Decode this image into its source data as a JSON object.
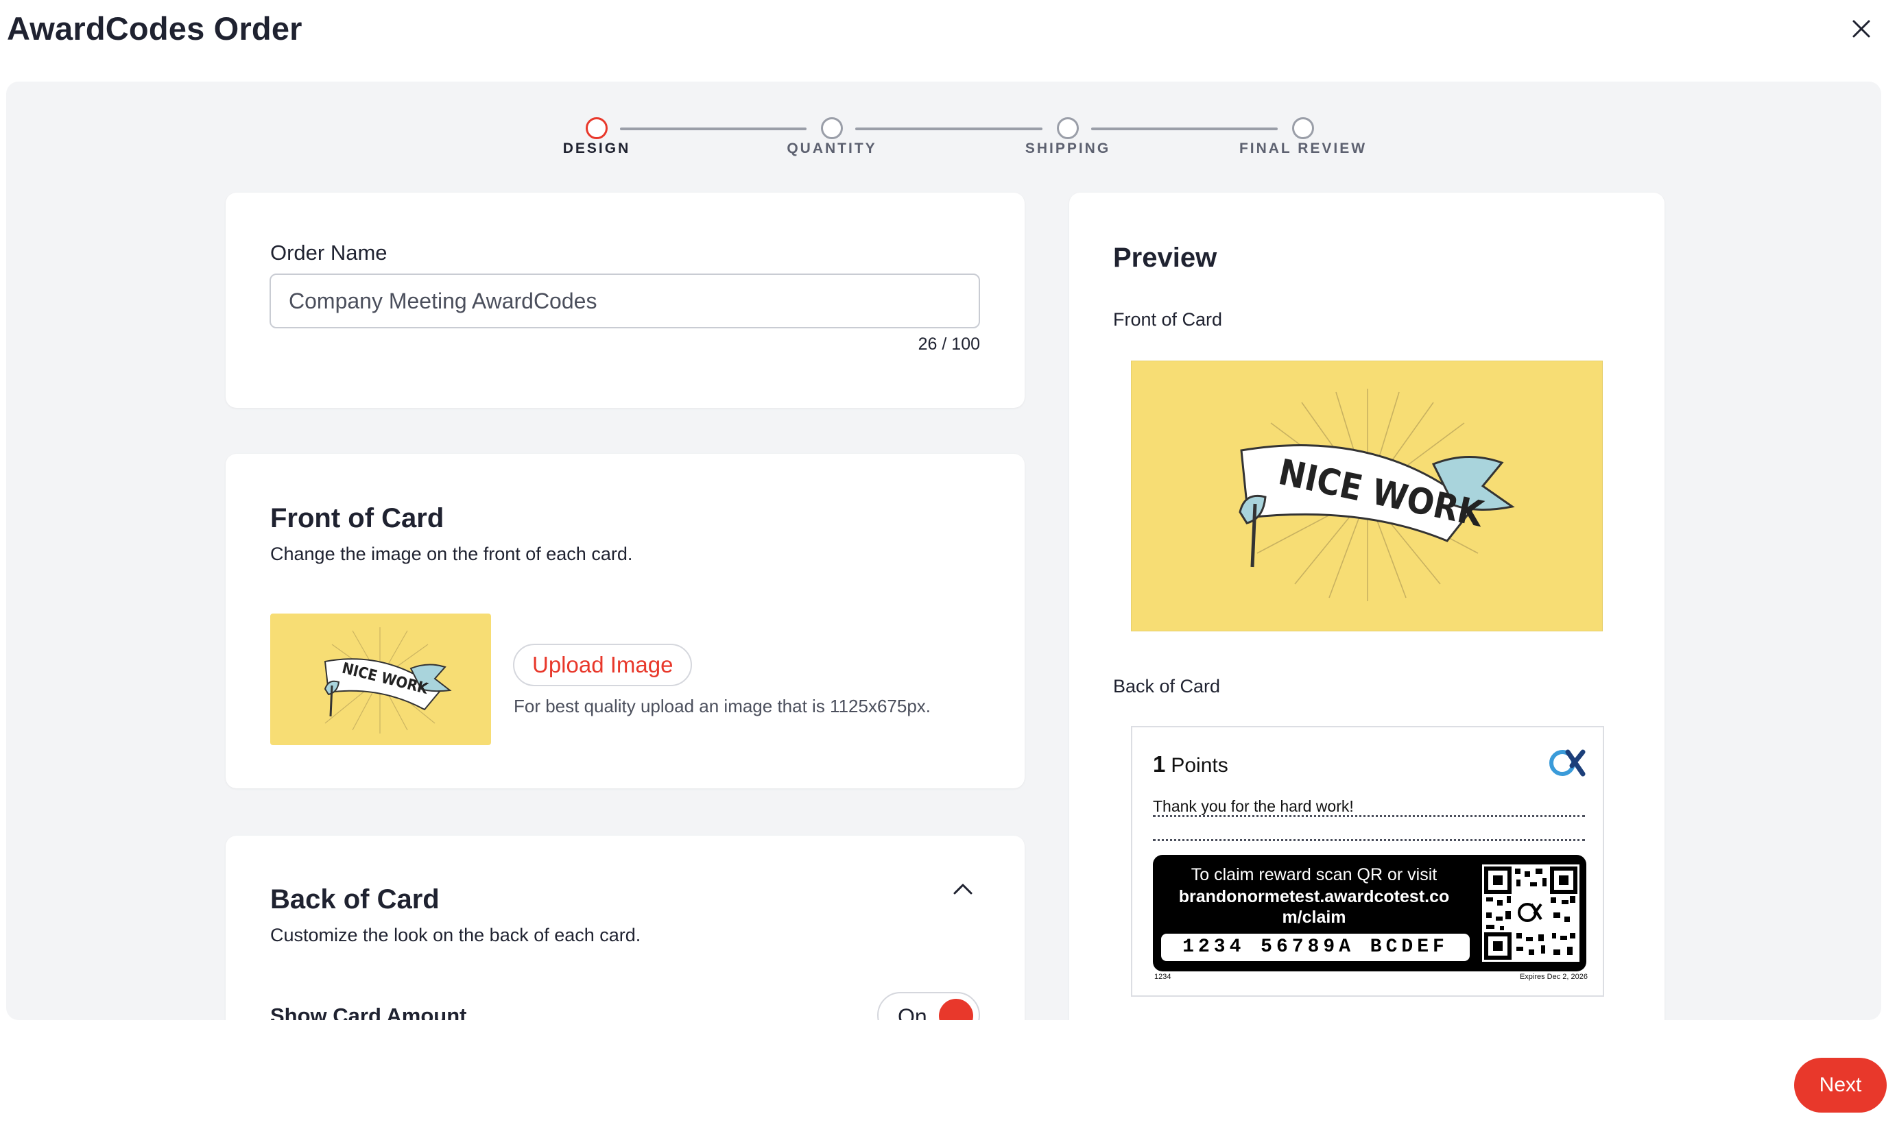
{
  "header": {
    "title": "AwardCodes Order"
  },
  "stepper": {
    "steps": [
      {
        "label": "DESIGN",
        "active": true
      },
      {
        "label": "QUANTITY",
        "active": false
      },
      {
        "label": "SHIPPING",
        "active": false
      },
      {
        "label": "FINAL REVIEW",
        "active": false
      }
    ]
  },
  "order_name": {
    "label": "Order Name",
    "value": "Company Meeting AwardCodes",
    "counter": "26 / 100"
  },
  "front": {
    "heading": "Front of Card",
    "description": "Change the image on the front of each card.",
    "upload_label": "Upload Image",
    "hint": "For best quality upload an image that is 1125x675px.",
    "image_text": "NICE WORK"
  },
  "back": {
    "heading": "Back of Card",
    "description": "Customize the look on the back of each card.",
    "show_amount_label": "Show Card Amount",
    "toggle_label": "On",
    "toggle_on": true
  },
  "preview": {
    "heading": "Preview",
    "front_label": "Front of Card",
    "back_label": "Back of Card",
    "card": {
      "points_value": "1",
      "points_unit": "Points",
      "message": "Thank you for the hard work!",
      "claim_text": "To claim reward scan QR or visit",
      "claim_url_line1": "brandonormetest.awardcotest.co",
      "claim_url_line2": "m/claim",
      "code": "1234 56789A BCDEF",
      "footer_left": "1234",
      "footer_right": "Expires Dec 2, 2026"
    }
  },
  "footer": {
    "next_label": "Next"
  },
  "colors": {
    "accent": "#e8382b",
    "background": "#f3f4f6",
    "card_yellow": "#f7dd74",
    "text": "#1f2230"
  },
  "icons": {
    "close": "close-icon",
    "collapse": "chevron-up-icon",
    "brand": "awardco-logo-icon"
  }
}
